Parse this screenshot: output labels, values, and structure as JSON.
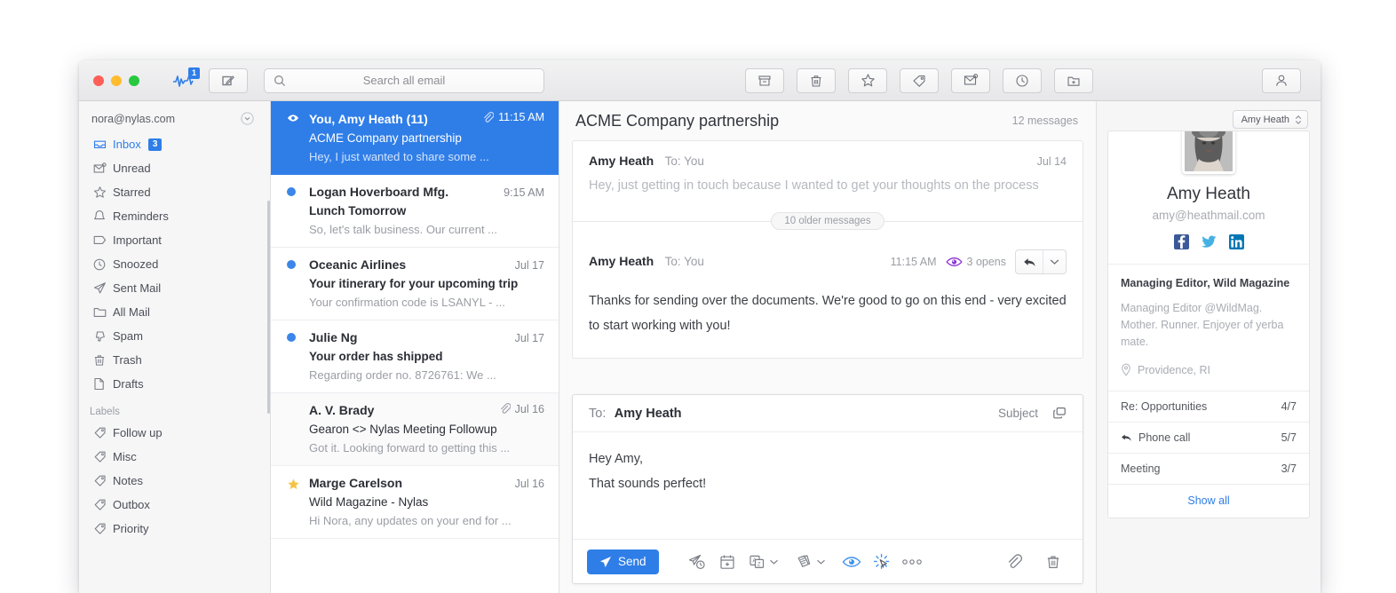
{
  "titlebar": {
    "activity_badge": "1",
    "search_placeholder": "Search all email",
    "search_value": "",
    "actions": [
      {
        "name": "archive-button",
        "label": "Archive"
      },
      {
        "name": "trash-button",
        "label": "Trash"
      },
      {
        "name": "star-button",
        "label": "Star"
      },
      {
        "name": "label-button",
        "label": "Label"
      },
      {
        "name": "mark-unread-button",
        "label": "Mark as unread"
      },
      {
        "name": "snooze-button",
        "label": "Snooze"
      },
      {
        "name": "move-to-folder-button",
        "label": "Move to folder"
      }
    ]
  },
  "sidebar": {
    "account_email": "nora@nylas.com",
    "items": [
      {
        "label": "Inbox",
        "icon": "inbox-icon",
        "badge": "3",
        "active": true
      },
      {
        "label": "Unread",
        "icon": "unread-icon",
        "badge": "",
        "active": false
      },
      {
        "label": "Starred",
        "icon": "star-icon",
        "badge": "",
        "active": false
      },
      {
        "label": "Reminders",
        "icon": "bell-icon",
        "badge": "",
        "active": false
      },
      {
        "label": "Important",
        "icon": "tag-important-icon",
        "badge": "",
        "active": false
      },
      {
        "label": "Snoozed",
        "icon": "clock-icon",
        "badge": "",
        "active": false
      },
      {
        "label": "Sent Mail",
        "icon": "paper-plane-icon",
        "badge": "",
        "active": false
      },
      {
        "label": "All Mail",
        "icon": "folder-icon",
        "badge": "",
        "active": false
      },
      {
        "label": "Spam",
        "icon": "thumbs-down-icon",
        "badge": "",
        "active": false
      },
      {
        "label": "Trash",
        "icon": "trash-icon",
        "badge": "",
        "active": false
      },
      {
        "label": "Drafts",
        "icon": "document-icon",
        "badge": "",
        "active": false
      }
    ],
    "labels_heading": "Labels",
    "labels": [
      {
        "label": "Follow up",
        "icon": "tag-icon"
      },
      {
        "label": "Misc",
        "icon": "tag-icon"
      },
      {
        "label": "Notes",
        "icon": "tag-icon"
      },
      {
        "label": "Outbox",
        "icon": "tag-icon"
      },
      {
        "label": "Priority",
        "icon": "tag-icon"
      }
    ]
  },
  "maillist": {
    "rows": [
      {
        "from": "You, Amy Heath (11)",
        "subject": "ACME Company partnership",
        "snippet": "Hey, I just wanted to share some ...",
        "time": "11:15 AM",
        "marker": "eye-icon",
        "attachment": true,
        "selected": true,
        "read": false
      },
      {
        "from": "Logan Hoverboard Mfg.",
        "subject": "Lunch Tomorrow",
        "snippet": "So, let's talk business. Our current ...",
        "time": "9:15 AM",
        "marker": "unread-dot",
        "attachment": false,
        "selected": false,
        "read": false
      },
      {
        "from": "Oceanic Airlines",
        "subject": "Your itinerary for your upcoming trip",
        "snippet": "Your confirmation code is LSANYL - ...",
        "time": "Jul 17",
        "marker": "unread-dot",
        "attachment": false,
        "selected": false,
        "read": false
      },
      {
        "from": "Julie Ng",
        "subject": "Your order has shipped",
        "snippet": "Regarding order no. 8726761: We ...",
        "time": "Jul 17",
        "marker": "unread-dot",
        "attachment": false,
        "selected": false,
        "read": false
      },
      {
        "from": "A. V. Brady",
        "subject": "Gearon <> Nylas Meeting Followup",
        "snippet": "Got it. Looking forward to getting this ...",
        "time": "Jul 16",
        "marker": "none",
        "attachment": true,
        "selected": false,
        "read": true
      },
      {
        "from": "Marge Carelson",
        "subject": "Wild Magazine - Nylas",
        "snippet": "Hi Nora, any updates on your end for ...",
        "time": "Jul 16",
        "marker": "star-icon",
        "attachment": false,
        "selected": false,
        "read": true
      }
    ]
  },
  "thread": {
    "subject": "ACME Company partnership",
    "message_count": "12 messages",
    "older_pill": "10 older messages",
    "collapsed_message": {
      "from": "Amy Heath",
      "to": "To: You",
      "date": "Jul 14",
      "preview": "Hey, just getting in touch because I wanted to get your thoughts on the process"
    },
    "open_message": {
      "from": "Amy Heath",
      "to": "To: You",
      "time": "11:15 AM",
      "opens": "3 opens",
      "body": "Thanks for sending over the documents. We're good to go on this end - very excited to start working with you!"
    }
  },
  "composer": {
    "to_label": "To:",
    "to_name": "Amy Heath",
    "subject_link": "Subject",
    "body_lines": [
      "Hey Amy,",
      "That sounds perfect!"
    ],
    "send_label": "Send",
    "toolbar": [
      {
        "name": "send-later-icon",
        "label": "Send later"
      },
      {
        "name": "calendar-add-icon",
        "label": "Insert availability"
      },
      {
        "name": "template-icon",
        "label": "Templates"
      },
      {
        "name": "snippet-icon",
        "label": "Snippets"
      },
      {
        "name": "read-receipt-icon",
        "label": "Read receipts"
      },
      {
        "name": "link-tracking-icon",
        "label": "Link tracking"
      },
      {
        "name": "more-options-icon",
        "label": "More options"
      },
      {
        "name": "attach-icon",
        "label": "Attach file"
      },
      {
        "name": "discard-draft-icon",
        "label": "Discard draft"
      }
    ]
  },
  "contact": {
    "selector_label": "Amy Heath",
    "name": "Amy Heath",
    "email": "amy@heathmail.com",
    "social": [
      "facebook-icon",
      "twitter-icon",
      "linkedin-icon"
    ],
    "title": "Managing Editor, Wild Magazine",
    "bio": "Managing Editor @WildMag.\nMother. Runner. Enjoyer of yerba mate.",
    "location": "Providence, RI",
    "stats": [
      {
        "label": "Re: Opportunities",
        "value": "4/7",
        "icon": "none"
      },
      {
        "label": "Phone call",
        "value": "5/7",
        "icon": "reply-icon"
      },
      {
        "label": "Meeting",
        "value": "3/7",
        "icon": "none"
      }
    ],
    "show_all": "Show all"
  },
  "colors": {
    "accent": "#2f7ee8",
    "selected_row": "#2f7ee8",
    "star": "#f5c242",
    "opens_purple": "#8b2fd6",
    "chrome": "#f2f2f3"
  }
}
